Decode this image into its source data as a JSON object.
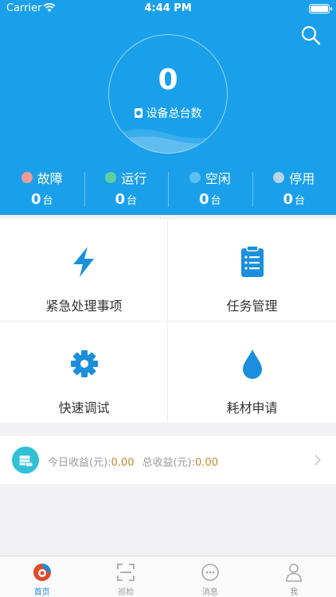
{
  "status_bar": {
    "carrier": "Carrier",
    "time": "4:44 PM"
  },
  "summary": {
    "total_value": "0",
    "total_label": "设备总台数"
  },
  "stats": [
    {
      "label": "故障",
      "count": "0",
      "unit": "台",
      "color": "#f19a9a"
    },
    {
      "label": "运行",
      "count": "0",
      "unit": "台",
      "color": "#5fcfa0"
    },
    {
      "label": "空闲",
      "count": "0",
      "unit": "台",
      "color": "#5cc0f7"
    },
    {
      "label": "停用",
      "count": "0",
      "unit": "台",
      "color": "#b8d4ea"
    }
  ],
  "menu": [
    {
      "label": "紧急处理事项",
      "icon": "lightning-icon"
    },
    {
      "label": "任务管理",
      "icon": "clipboard-icon"
    },
    {
      "label": "快速调试",
      "icon": "gear-icon"
    },
    {
      "label": "耗材申请",
      "icon": "drop-icon"
    }
  ],
  "income": {
    "today_label": "今日收益(元):",
    "today_value": "0.00",
    "total_label": "总收益(元):",
    "total_value": "0.00"
  },
  "tabs": [
    {
      "label": "首页",
      "icon": "home-logo-icon",
      "active": true
    },
    {
      "label": "巡检",
      "icon": "scan-icon",
      "active": false
    },
    {
      "label": "消息",
      "icon": "chat-icon",
      "active": false
    },
    {
      "label": "我",
      "icon": "user-icon",
      "active": false
    }
  ],
  "colors": {
    "primary": "#1aa0ea",
    "icon_blue": "#1a8fdc",
    "income_value": "#c0892a"
  }
}
